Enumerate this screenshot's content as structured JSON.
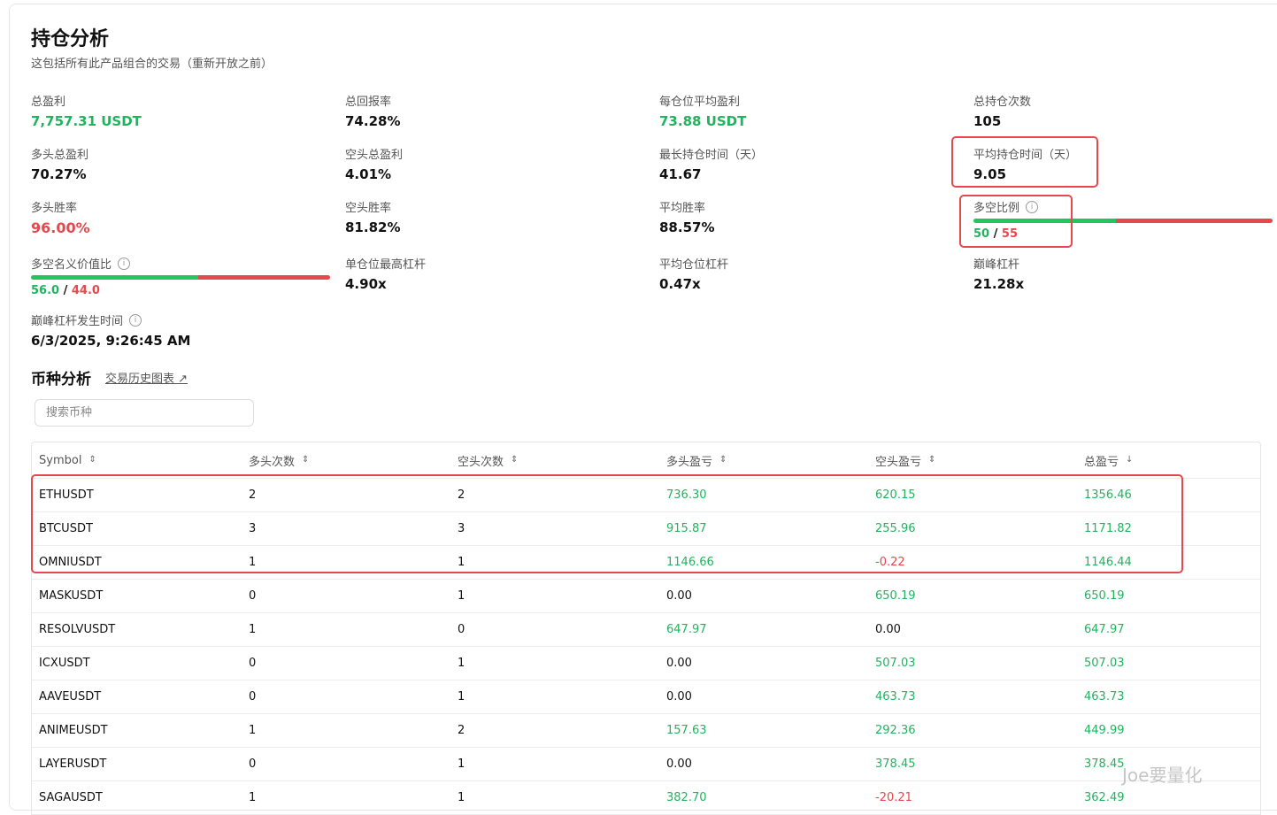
{
  "header": {
    "title": "持仓分析",
    "subtitle": "这包括所有此产品组合的交易（重新开放之前）"
  },
  "stats": {
    "total_pnl": {
      "label": "总盈利",
      "value": "7,757.31 USDT"
    },
    "total_return": {
      "label": "总回报率",
      "value": "74.28%"
    },
    "avg_pnl_per_position": {
      "label": "每仓位平均盈利",
      "value": "73.88 USDT"
    },
    "total_positions": {
      "label": "总持仓次数",
      "value": "105"
    },
    "long_total_pnl": {
      "label": "多头总盈利",
      "value": "70.27%"
    },
    "short_total_pnl": {
      "label": "空头总盈利",
      "value": "4.01%"
    },
    "longest_hold": {
      "label": "最长持仓时间（天）",
      "value": "41.67"
    },
    "avg_hold": {
      "label": "平均持仓时间（天）",
      "value": "9.05"
    },
    "long_win_rate": {
      "label": "多头胜率",
      "value": "96.00%"
    },
    "short_win_rate": {
      "label": "空头胜率",
      "value": "81.82%"
    },
    "avg_win_rate": {
      "label": "平均胜率",
      "value": "88.57%"
    },
    "long_short_ratio": {
      "label": "多空比例",
      "long": "50",
      "short": "55",
      "sep": "/",
      "long_fraction": 0.476
    },
    "notional_ratio": {
      "label": "多空名义价值比",
      "long": "56.0",
      "short": "44.0",
      "sep": "/",
      "long_fraction": 0.56
    },
    "max_leverage_single": {
      "label": "单仓位最高杠杆",
      "value": "4.90x"
    },
    "avg_leverage": {
      "label": "平均仓位杠杆",
      "value": "0.47x"
    },
    "peak_leverage": {
      "label": "巅峰杠杆",
      "value": "21.28x"
    },
    "peak_leverage_time": {
      "label": "巅峰杠杆发生时间",
      "value": "6/3/2025, 9:26:45 AM"
    }
  },
  "coin_section": {
    "title": "币种分析",
    "link": "交易历史图表 ↗",
    "search_placeholder": "搜索币种"
  },
  "table": {
    "headers": [
      "Symbol",
      "多头次数",
      "空头次数",
      "多头盈亏",
      "空头盈亏",
      "总盈亏"
    ],
    "sort_icons": [
      "⇕",
      "⇕",
      "⇕",
      "⇕",
      "⇕",
      "↓"
    ],
    "rows": [
      {
        "symbol": "ETHUSDT",
        "long_count": "2",
        "short_count": "2",
        "long_pnl": "736.30",
        "short_pnl": "620.15",
        "total_pnl": "1356.46"
      },
      {
        "symbol": "BTCUSDT",
        "long_count": "3",
        "short_count": "3",
        "long_pnl": "915.87",
        "short_pnl": "255.96",
        "total_pnl": "1171.82"
      },
      {
        "symbol": "OMNIUSDT",
        "long_count": "1",
        "short_count": "1",
        "long_pnl": "1146.66",
        "short_pnl": "-0.22",
        "total_pnl": "1146.44"
      },
      {
        "symbol": "MASKUSDT",
        "long_count": "0",
        "short_count": "1",
        "long_pnl": "0.00",
        "short_pnl": "650.19",
        "total_pnl": "650.19"
      },
      {
        "symbol": "RESOLVUSDT",
        "long_count": "1",
        "short_count": "0",
        "long_pnl": "647.97",
        "short_pnl": "0.00",
        "total_pnl": "647.97"
      },
      {
        "symbol": "ICXUSDT",
        "long_count": "0",
        "short_count": "1",
        "long_pnl": "0.00",
        "short_pnl": "507.03",
        "total_pnl": "507.03"
      },
      {
        "symbol": "AAVEUSDT",
        "long_count": "0",
        "short_count": "1",
        "long_pnl": "0.00",
        "short_pnl": "463.73",
        "total_pnl": "463.73"
      },
      {
        "symbol": "ANIMEUSDT",
        "long_count": "1",
        "short_count": "2",
        "long_pnl": "157.63",
        "short_pnl": "292.36",
        "total_pnl": "449.99"
      },
      {
        "symbol": "LAYERUSDT",
        "long_count": "0",
        "short_count": "1",
        "long_pnl": "0.00",
        "short_pnl": "378.45",
        "total_pnl": "378.45"
      },
      {
        "symbol": "SAGAUSDT",
        "long_count": "1",
        "short_count": "1",
        "long_pnl": "382.70",
        "short_pnl": "-20.21",
        "total_pnl": "362.49"
      }
    ]
  },
  "watermark": "Joe要量化",
  "colors": {
    "positive": "#22b35e",
    "negative": "#e5484d",
    "highlight": "#e5484d"
  }
}
